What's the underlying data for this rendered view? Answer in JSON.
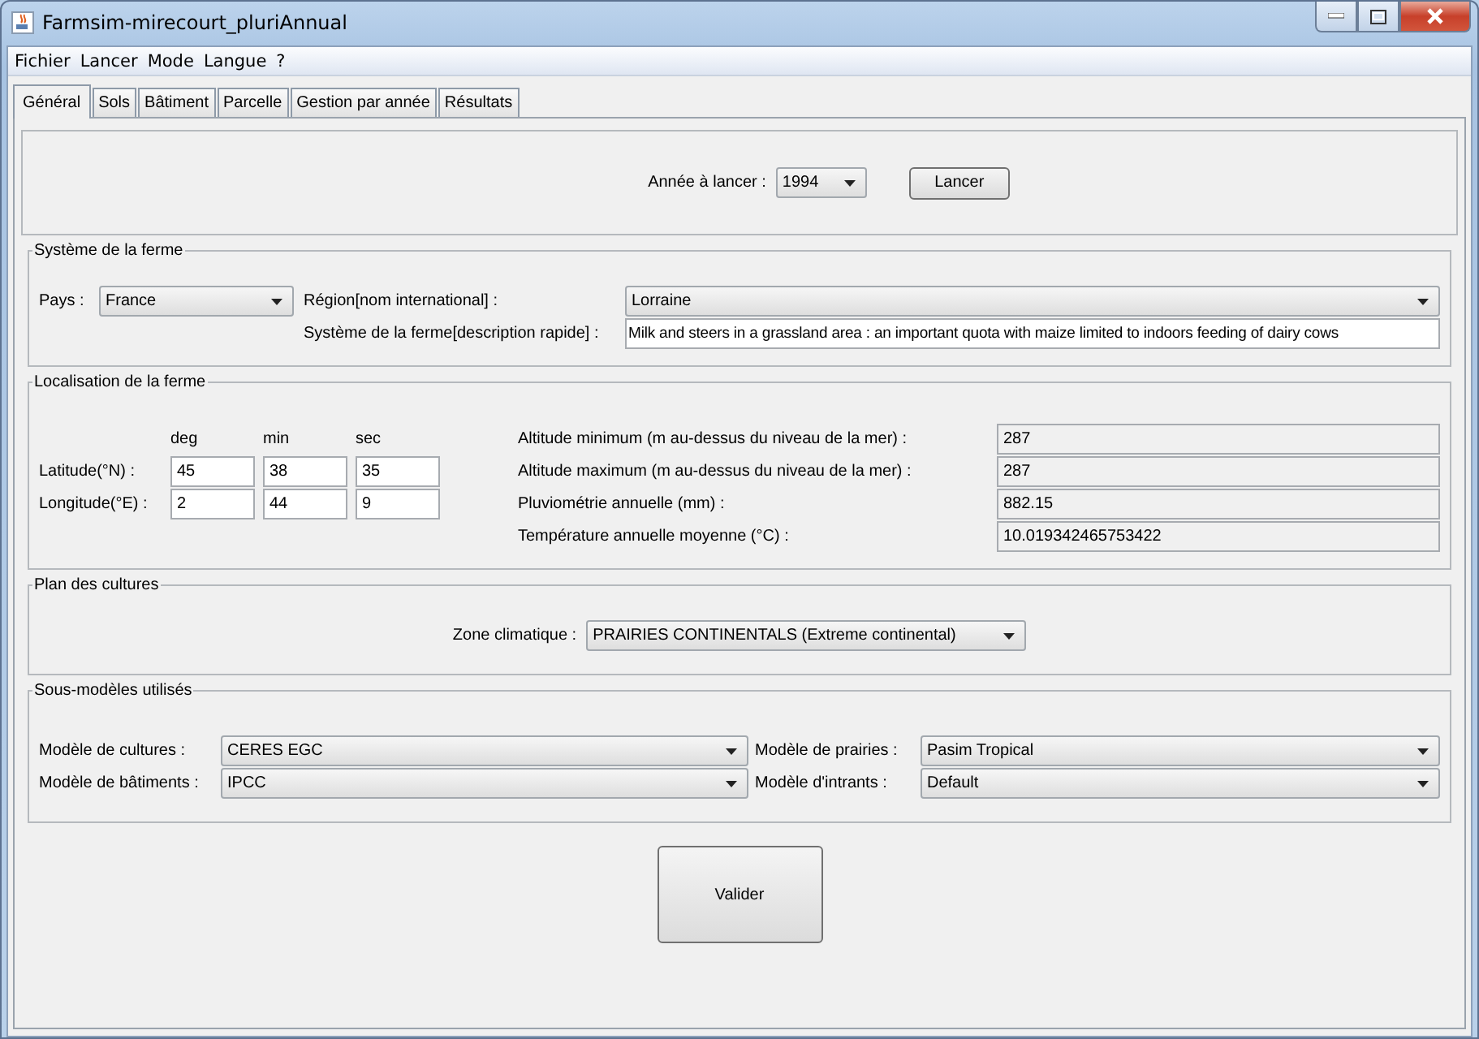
{
  "window": {
    "title": "Farmsim-mirecourt_pluriAnnual"
  },
  "menu": [
    "Fichier",
    "Lancer",
    "Mode",
    "Langue",
    "?"
  ],
  "tabs": [
    {
      "label": "Général",
      "selected": true
    },
    {
      "label": "Sols",
      "selected": false
    },
    {
      "label": "Bâtiment",
      "selected": false
    },
    {
      "label": "Parcelle",
      "selected": false
    },
    {
      "label": "Gestion par année",
      "selected": false
    },
    {
      "label": "Résultats",
      "selected": false
    }
  ],
  "launch": {
    "label": "Année à lancer :",
    "year": "1994",
    "button": "Lancer"
  },
  "farm_system": {
    "title": "Système de la ferme",
    "country_label": "Pays :",
    "country": "France",
    "region_label": "Région[nom international] :",
    "region": "Lorraine",
    "description_label": "Système de la ferme[description rapide] :",
    "description": "Milk and steers in a grassland area : an important quota with maize limited to indoors feeding of dairy cows"
  },
  "location": {
    "title": "Localisation de la ferme",
    "columns": [
      "deg",
      "min",
      "sec"
    ],
    "coords": [
      {
        "label": "Latitude(°N) :",
        "values": [
          "45",
          "38",
          "35"
        ]
      },
      {
        "label": "Longitude(°E) :",
        "values": [
          "2",
          "44",
          "9"
        ]
      }
    ],
    "properties": [
      {
        "label": "Altitude minimum (m au-dessus du niveau de la mer) :",
        "value": "287"
      },
      {
        "label": "Altitude maximum (m au-dessus du niveau de la mer) :",
        "value": "287"
      },
      {
        "label": "Pluviométrie annuelle (mm) :",
        "value": "882.15"
      },
      {
        "label": "Température annuelle moyenne (°C) :",
        "value": "10.019342465753422"
      }
    ]
  },
  "crop_plan": {
    "title": "Plan des cultures",
    "zone_label": "Zone climatique :",
    "zone": "PRAIRIES CONTINENTALS (Extreme continental)"
  },
  "submodels": {
    "title": "Sous-modèles utilisés",
    "items": [
      {
        "label": "Modèle de cultures :",
        "value": "CERES EGC"
      },
      {
        "label": "Modèle de prairies :",
        "value": "Pasim Tropical"
      },
      {
        "label": "Modèle de bâtiments :",
        "value": "IPCC"
      },
      {
        "label": "Modèle d'intrants :",
        "value": "Default"
      }
    ]
  },
  "validate_button": "Valider"
}
